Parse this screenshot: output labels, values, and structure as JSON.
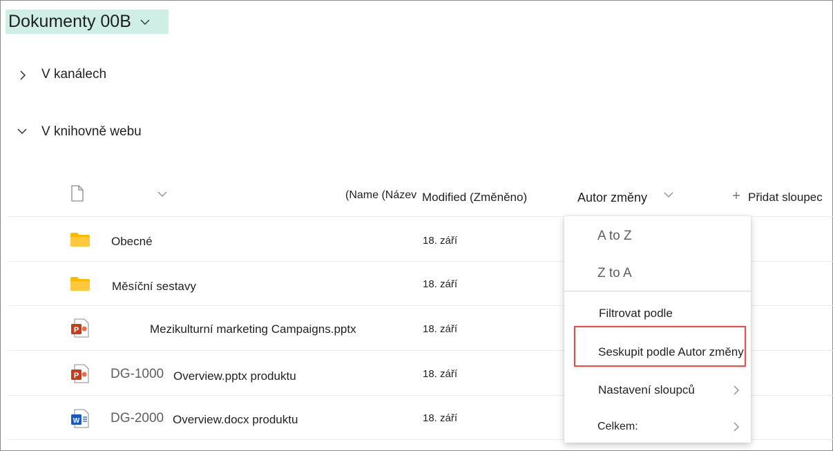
{
  "library": {
    "title": "Dokumenty 00B"
  },
  "sections": [
    {
      "label": "V kanálech",
      "expanded": false
    },
    {
      "label": "V knihovně webu",
      "expanded": true
    }
  ],
  "columns": {
    "name": "(Name (Název",
    "modified": "Modified (Změněno)",
    "author": "Autor změny",
    "add": "Přidat sloupec"
  },
  "rows": [
    {
      "type": "folder",
      "prefix": "",
      "name": "Obecné",
      "modified": "18. září"
    },
    {
      "type": "folder",
      "prefix": "",
      "name": "Měsíční sestavy",
      "modified": "18. září"
    },
    {
      "type": "pptx",
      "prefix": "",
      "name": "Mezikulturní marketing Campaigns.pptx",
      "modified": "18. září"
    },
    {
      "type": "pptx",
      "prefix": "DG-1000",
      "name": "Overview.pptx produktu",
      "modified": "18. září"
    },
    {
      "type": "docx",
      "prefix": "DG-2000",
      "name": "Overview.docx produktu",
      "modified": "18. září"
    }
  ],
  "menu": {
    "sort_asc": "A to Z",
    "sort_desc": "Z to A",
    "filter": "Filtrovat podle",
    "group": "Seskupit podle Autor změny",
    "column_settings": "Nastavení sloupců",
    "totals": "Celkem:"
  },
  "colors": {
    "title_highlight": "#cfeee6",
    "folder": "#ffb900",
    "powerpoint": "#c43e1c",
    "word": "#185abd",
    "highlight_border": "#d9534f"
  }
}
